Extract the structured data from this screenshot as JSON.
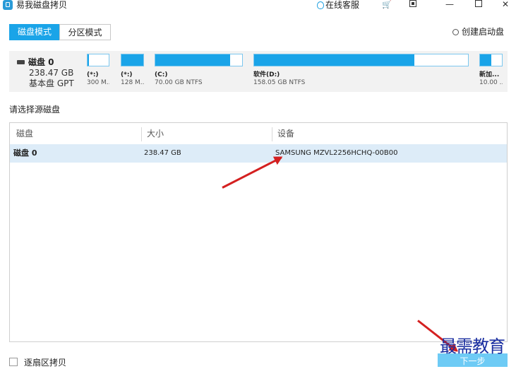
{
  "app": {
    "title": "易我磁盘拷贝",
    "online_support": "在线客服"
  },
  "tabs": {
    "disk_mode": "磁盘模式",
    "partition_mode": "分区模式"
  },
  "create_boot_disk": "创建启动盘",
  "disk": {
    "name": "磁盘 0",
    "size": "238.47 GB",
    "type": "基本盘 GPT"
  },
  "partitions": [
    {
      "name": "(*:)",
      "size": "300 M...",
      "used_fraction": 0.05
    },
    {
      "name": "(*:)",
      "size": "128 M...",
      "used_fraction": 1.0
    },
    {
      "name": "(C:)",
      "size": "70.00 GB NTFS",
      "used_fraction": 0.86
    },
    {
      "name": "软件(D:)",
      "size": "158.05 GB NTFS",
      "used_fraction": 0.75
    },
    {
      "name": "新加...",
      "size": "10.00 ...",
      "used_fraction": 0.5
    }
  ],
  "source_prompt": "请选择源磁盘",
  "table": {
    "headers": [
      "磁盘",
      "大小",
      "设备"
    ],
    "rows": [
      {
        "disk": "磁盘 0",
        "size": "238.47 GB",
        "device": "SAMSUNG MZVL2256HCHQ-00B00"
      }
    ]
  },
  "sector_copy_label": "逐扇区拷贝",
  "next_button": "下一步",
  "watermark": "最需教育",
  "colors": {
    "accent": "#1aa4e8",
    "selected_row": "#ddecf8",
    "annotation": "#d42020"
  }
}
